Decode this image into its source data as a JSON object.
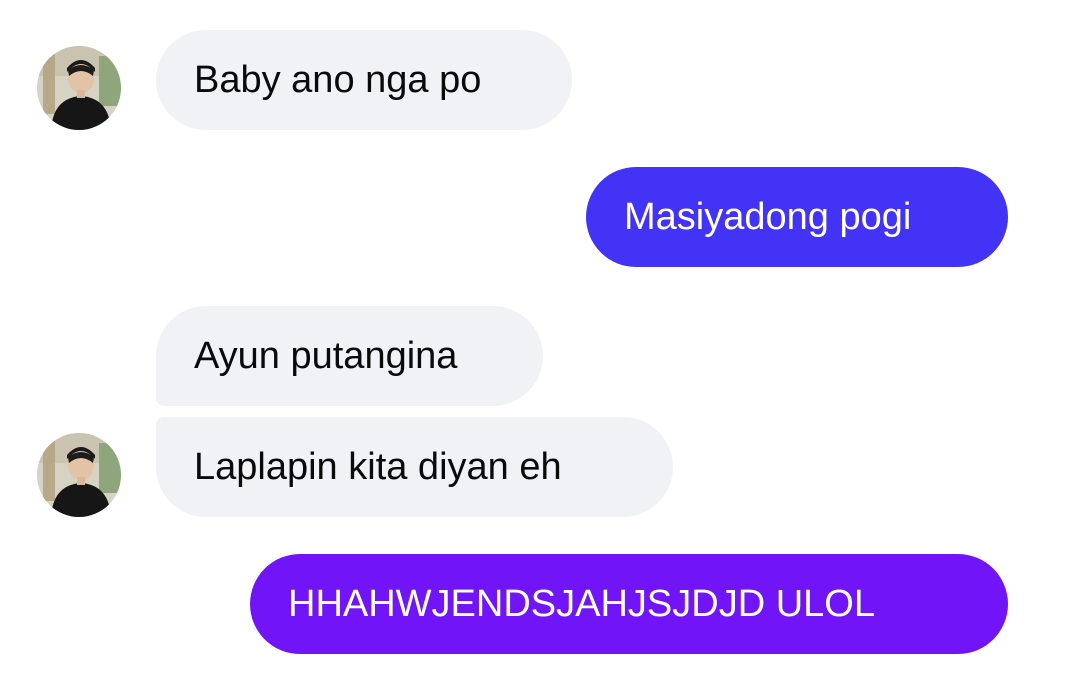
{
  "conversation": {
    "messages": [
      {
        "sender": "other",
        "text": "Baby ano nga po"
      },
      {
        "sender": "me",
        "text": "Masiyadong pogi"
      },
      {
        "sender": "other",
        "text": "Ayun putangina"
      },
      {
        "sender": "other",
        "text": "Laplapin kita diyan eh"
      },
      {
        "sender": "me",
        "text": "HHAHWJENDSJAHJSJDJD ULOL"
      }
    ]
  },
  "colors": {
    "incoming_bubble": "#f1f2f6",
    "outgoing_bubble_1": "#4233f7",
    "outgoing_bubble_2": "#7115f8",
    "incoming_text": "#0a0a0a",
    "outgoing_text": "#ffffff"
  }
}
